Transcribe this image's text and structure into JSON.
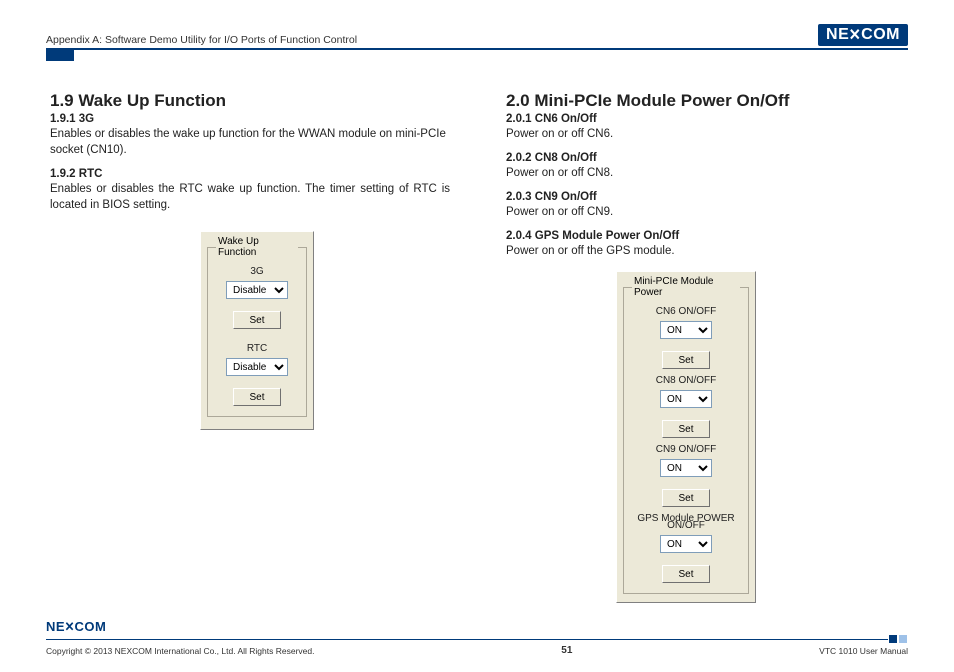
{
  "header": {
    "title": "Appendix A: Software Demo Utility for I/O Ports of Function Control",
    "logo": "NEXCOM"
  },
  "left": {
    "h": "1.9  Wake Up Function",
    "s1": "1.9.1  3G",
    "p1": "Enables or disables the wake up function for the WWAN module on mini-PCIe socket (CN10).",
    "s2": "1.9.2  RTC",
    "p2": "Enables or disables the RTC wake up function. The timer setting of RTC is located in BIOS setting.",
    "panel": {
      "legend": "Wake Up Function",
      "lab1": "3G",
      "val1": "Disable",
      "set1": "Set",
      "lab2": "RTC",
      "val2": "Disable",
      "set2": "Set"
    }
  },
  "right": {
    "h": "2.0  Mini-PCIe Module Power On/Off",
    "s1": "2.0.1  CN6 On/Off",
    "p1": "Power on or off CN6.",
    "s2": "2.0.2  CN8 On/Off",
    "p2": "Power on or off CN8.",
    "s3": "2.0.3  CN9 On/Off",
    "p3": "Power on or off CN9.",
    "s4": "2.0.4  GPS Module Power On/Off",
    "p4": "Power on or off the GPS module.",
    "panel": {
      "legend": "Mini-PCIe Module Power",
      "lab1": "CN6 ON/OFF",
      "val1": "ON",
      "set1": "Set",
      "lab2": "CN8 ON/OFF",
      "val2": "ON",
      "set2": "Set",
      "lab3": "CN9 ON/OFF",
      "val3": "ON",
      "set3": "Set",
      "lab4a": "GPS Module POWER",
      "lab4b": "ON/OFF",
      "val4": "ON",
      "set4": "Set"
    }
  },
  "footer": {
    "logo": "NEXCOM",
    "copy": "Copyright © 2013 NEXCOM International Co., Ltd. All Rights Reserved.",
    "page": "51",
    "doc": "VTC 1010 User Manual"
  }
}
